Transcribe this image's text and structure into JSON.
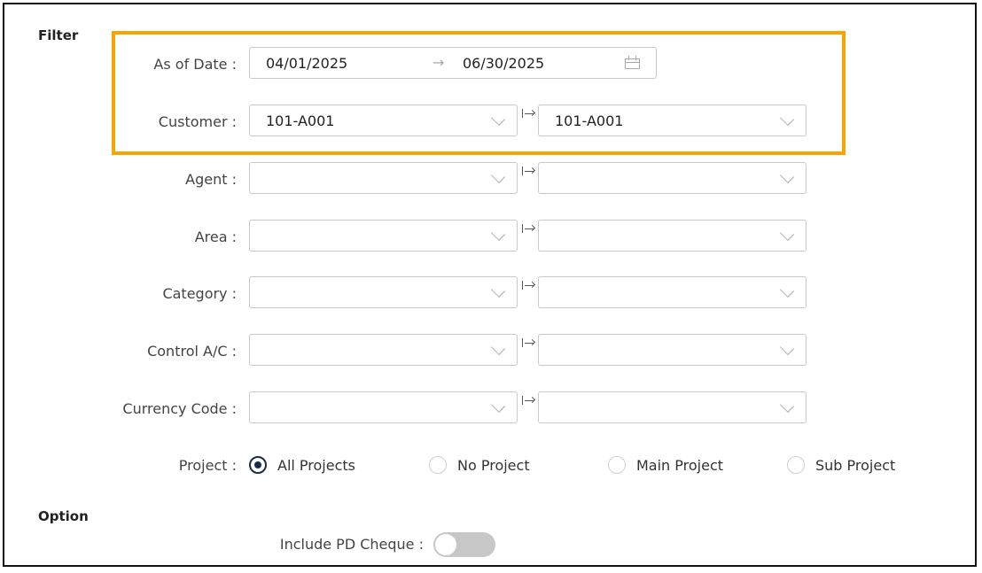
{
  "filter": {
    "title": "Filter",
    "as_of_date": {
      "label": "As of Date :",
      "from": "04/01/2025",
      "arrow": "→",
      "to": "06/30/2025"
    },
    "ranges": [
      {
        "key": "customer",
        "label": "Customer :",
        "from": "101-A001",
        "to": "101-A001"
      },
      {
        "key": "agent",
        "label": "Agent :",
        "from": "",
        "to": ""
      },
      {
        "key": "area",
        "label": "Area :",
        "from": "",
        "to": ""
      },
      {
        "key": "category",
        "label": "Category :",
        "from": "",
        "to": ""
      },
      {
        "key": "control_ac",
        "label": "Control A/C :",
        "from": "",
        "to": ""
      },
      {
        "key": "currency_code",
        "label": "Currency Code :",
        "from": "",
        "to": ""
      }
    ],
    "project": {
      "label": "Project :",
      "options": [
        "All Projects",
        "No Project",
        "Main Project",
        "Sub Project"
      ],
      "selected": "All Projects"
    }
  },
  "option": {
    "title": "Option",
    "include_pd_cheque": {
      "label": "Include PD Cheque :",
      "value": false
    }
  },
  "colors": {
    "highlight": "#f7a500",
    "radio_selected": "#1b2a4e",
    "toggle_off": "#c7c7c7"
  }
}
